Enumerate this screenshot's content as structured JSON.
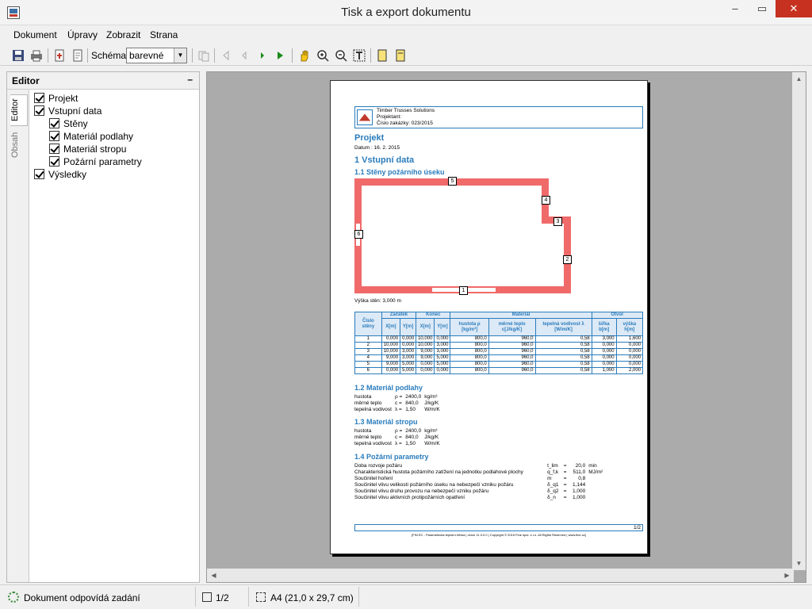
{
  "window": {
    "title": "Tisk a export dokumentu"
  },
  "menu": [
    "Dokument",
    "Úpravy",
    "Zobrazit",
    "Strana"
  ],
  "toolbar": {
    "schema_label": "Schéma:",
    "schema_value": "barevné"
  },
  "editor": {
    "title": "Editor",
    "tabs": [
      "Editor",
      "Obsah"
    ],
    "tree": [
      {
        "label": "Projekt",
        "level": 0,
        "checked": true
      },
      {
        "label": "Vstupní data",
        "level": 0,
        "checked": true
      },
      {
        "label": "Stěny",
        "level": 1,
        "checked": true
      },
      {
        "label": "Materiál podlahy",
        "level": 1,
        "checked": true
      },
      {
        "label": "Materiál stropu",
        "level": 1,
        "checked": true
      },
      {
        "label": "Požární parametry",
        "level": 1,
        "checked": true
      },
      {
        "label": "Výsledky",
        "level": 0,
        "checked": true
      }
    ]
  },
  "doc": {
    "company": "Timber Trusses Solutions",
    "designer": "Projektant:",
    "order": "Číslo zakázky: 023/2015",
    "project_heading": "Projekt",
    "date": "Datum  :  16. 2. 2015",
    "sec1": "1 Vstupní data",
    "sec11": "1.1 Stěny požárního úseku",
    "wall_height": "Výška stěn: 3,000 m",
    "wall_labels": [
      "1",
      "2",
      "3",
      "4",
      "5",
      "6"
    ],
    "table_head1": [
      "Číslo stěny",
      "Začátek",
      "Konec",
      "Materiál",
      "Otvor"
    ],
    "table_head2": [
      "X[m]",
      "Y[m]",
      "X[m]",
      "Y[m]",
      "hustota ρ [kg/m³]",
      "měrné teplo c[J/kg/K]",
      "tepelná vodivost λ [W/m/K]",
      "šířka b[m]",
      "výška h[m]"
    ],
    "rows": [
      [
        "1",
        "0,000",
        "0,000",
        "10,000",
        "0,000",
        "800,0",
        "960,0",
        "0,58",
        "3,000",
        "1,600"
      ],
      [
        "2",
        "10,000",
        "0,000",
        "10,000",
        "3,000",
        "800,0",
        "960,0",
        "0,58",
        "0,000",
        "0,000"
      ],
      [
        "3",
        "10,000",
        "3,000",
        "9,000",
        "3,000",
        "800,0",
        "960,0",
        "0,58",
        "0,000",
        "0,000"
      ],
      [
        "4",
        "9,000",
        "3,000",
        "9,000",
        "5,000",
        "800,0",
        "960,0",
        "0,58",
        "0,000",
        "0,000"
      ],
      [
        "5",
        "9,000",
        "5,000",
        "0,000",
        "5,000",
        "800,0",
        "960,0",
        "0,58",
        "0,000",
        "0,000"
      ],
      [
        "6",
        "0,000",
        "5,000",
        "0,000",
        "0,000",
        "800,0",
        "960,0",
        "0,58",
        "1,000",
        "2,000"
      ]
    ],
    "sec12": "1.2 Materiál podlahy",
    "floor": [
      [
        "hustota",
        "ρ =",
        "2400,0",
        "kg/m³"
      ],
      [
        "měrné teplo",
        "c =",
        "840,0",
        "J/kg/K"
      ],
      [
        "tepelná vodivost",
        "λ =",
        "1,50",
        "W/m/K"
      ]
    ],
    "sec13": "1.3 Materiál stropu",
    "ceiling": [
      [
        "hustota",
        "ρ =",
        "2400,0",
        "kg/m³"
      ],
      [
        "měrné teplo",
        "c =",
        "840,0",
        "J/kg/K"
      ],
      [
        "tepelná vodivost",
        "λ =",
        "1,50",
        "W/m/K"
      ]
    ],
    "sec14": "1.4 Požární parametry",
    "fire": [
      [
        "Doba rozvoje požáru",
        "t_lim",
        "=",
        "20,0",
        "min"
      ],
      [
        "Charakteristická hustota požárního zatížení na jednotku podlahové plochy",
        "q_f,k",
        "=",
        "511,0",
        "MJ/m²"
      ],
      [
        "Součinitel hoření",
        "m",
        "=",
        "0,8",
        ""
      ],
      [
        "Součinitel vlivu velikosti požárního úseku na nebezpečí vzniku požáru",
        "δ_q1",
        "=",
        "1,144",
        ""
      ],
      [
        "Součinitel vlivu druhu provozu na nebezpečí vzniku požáru",
        "δ_q2",
        "=",
        "1,000",
        ""
      ],
      [
        "Součinitel vlivu aktivních protipožárních opatření",
        "δ_n",
        "=",
        "1,000",
        ""
      ]
    ],
    "page_no": "1/2",
    "footer": "[FIN EC - Parametrická teplotní křivka | verze 11.0.0.0 | Copyright © 2015 Fine spol. s r.o. All Rights Reserved | www.fine.cz]"
  },
  "status": {
    "message": "Dokument odpovídá zadání",
    "pages": "1/2",
    "paper": "A4 (21,0 x 29,7 cm)"
  },
  "colors": {
    "accent": "#2a7cbc",
    "wall": "#f06a6a",
    "close": "#c7311f"
  }
}
